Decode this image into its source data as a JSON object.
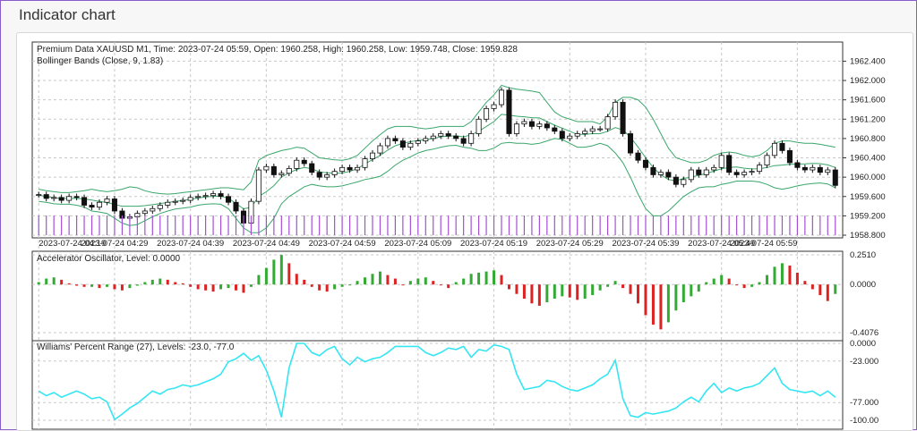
{
  "window": {
    "title": "Indicator chart"
  },
  "colors": {
    "bull": "#33aa33",
    "bear": "#dd2222",
    "wpr": "#33e6f2",
    "band": "#3aa66a",
    "accent": "#8a5cc8"
  },
  "chart_data": [
    {
      "type": "candlestick",
      "title": "Premium Data XAUUSD M1, Time: 2023-07-24 05:59, Open: 1960.258, High: 1960.258, Low: 1959.748, Close: 1959.828",
      "indicator_label": "Bollinger Bands (Close, 9, 1.83)",
      "ylim": [
        1958.8,
        1962.5
      ],
      "y_ticks": [
        "1962.400",
        "1962.000",
        "1961.600",
        "1961.200",
        "1960.800",
        "1960.400",
        "1960.000",
        "1959.600",
        "1959.200",
        "1958.800"
      ],
      "x_ticks": [
        "2023-07-24 04:19",
        "2023-07-24 04:29",
        "2023-07-24 04:39",
        "2023-07-24 04:49",
        "2023-07-24 04:59",
        "2023-07-24 05:09",
        "2023-07-24 05:19",
        "2023-07-24 05:29",
        "2023-07-24 05:39",
        "2023-07-24 05:49",
        "2023-07-24 05:59"
      ],
      "close": [
        1959.64,
        1959.56,
        1959.58,
        1959.52,
        1959.6,
        1959.58,
        1959.42,
        1959.38,
        1959.48,
        1959.55,
        1959.3,
        1959.15,
        1959.18,
        1959.25,
        1959.3,
        1959.35,
        1959.42,
        1959.48,
        1959.5,
        1959.52,
        1959.58,
        1959.6,
        1959.62,
        1959.66,
        1959.6,
        1959.48,
        1959.3,
        1959.05,
        1959.5,
        1960.15,
        1960.22,
        1960.05,
        1960.08,
        1960.18,
        1960.35,
        1960.28,
        1960.1,
        1960.0,
        1960.05,
        1960.12,
        1960.2,
        1960.15,
        1960.2,
        1960.38,
        1960.5,
        1960.65,
        1960.8,
        1960.75,
        1960.62,
        1960.7,
        1960.75,
        1960.8,
        1960.85,
        1960.9,
        1960.85,
        1960.8,
        1960.7,
        1960.9,
        1961.2,
        1961.42,
        1961.5,
        1961.8,
        1960.9,
        1961.1,
        1961.15,
        1961.05,
        1961.1,
        1961.02,
        1960.95,
        1960.8,
        1960.85,
        1960.9,
        1960.95,
        1961.0,
        1961.0,
        1961.25,
        1961.55,
        1960.9,
        1960.5,
        1960.35,
        1960.2,
        1960.05,
        1960.1,
        1960.0,
        1959.85,
        1959.95,
        1960.15,
        1960.05,
        1960.15,
        1960.2,
        1960.45,
        1960.1,
        1960.05,
        1960.1,
        1960.12,
        1960.25,
        1960.45,
        1960.7,
        1960.55,
        1960.3,
        1960.2,
        1960.15,
        1960.2,
        1960.1,
        1960.15,
        1959.83
      ],
      "bb_upper": [
        1959.75,
        1959.72,
        1959.7,
        1959.68,
        1959.68,
        1959.7,
        1959.72,
        1959.75,
        1959.72,
        1959.7,
        1959.72,
        1959.75,
        1959.8,
        1959.78,
        1959.72,
        1959.68,
        1959.66,
        1959.65,
        1959.66,
        1959.68,
        1959.7,
        1959.72,
        1959.74,
        1959.76,
        1959.78,
        1959.78,
        1959.76,
        1959.74,
        1959.9,
        1960.35,
        1960.45,
        1960.5,
        1960.55,
        1960.58,
        1960.62,
        1960.6,
        1960.5,
        1960.4,
        1960.38,
        1960.36,
        1960.35,
        1960.38,
        1960.45,
        1960.6,
        1960.75,
        1960.88,
        1961.0,
        1961.05,
        1961.05,
        1961.05,
        1961.02,
        1961.0,
        1961.02,
        1961.05,
        1961.05,
        1961.05,
        1961.05,
        1961.15,
        1961.35,
        1961.55,
        1961.7,
        1961.9,
        1961.85,
        1961.82,
        1961.8,
        1961.78,
        1961.75,
        1961.55,
        1961.35,
        1961.25,
        1961.2,
        1961.15,
        1961.15,
        1961.15,
        1961.1,
        1961.25,
        1961.55,
        1961.65,
        1961.65,
        1961.6,
        1961.45,
        1961.2,
        1960.9,
        1960.6,
        1960.4,
        1960.35,
        1960.3,
        1960.3,
        1960.35,
        1960.45,
        1960.5,
        1960.52,
        1960.5,
        1960.45,
        1960.42,
        1960.45,
        1960.55,
        1960.7,
        1960.75,
        1960.75,
        1960.72,
        1960.7,
        1960.7,
        1960.68,
        1960.65,
        1960.62
      ],
      "bb_lower": [
        1959.5,
        1959.48,
        1959.45,
        1959.44,
        1959.44,
        1959.42,
        1959.38,
        1959.3,
        1959.28,
        1959.25,
        1959.15,
        1959.05,
        1959.0,
        1959.02,
        1959.1,
        1959.18,
        1959.25,
        1959.3,
        1959.34,
        1959.36,
        1959.38,
        1959.42,
        1959.44,
        1959.45,
        1959.44,
        1959.35,
        1959.15,
        1958.95,
        1958.85,
        1958.85,
        1958.95,
        1959.15,
        1959.45,
        1959.6,
        1959.7,
        1959.8,
        1959.85,
        1959.82,
        1959.8,
        1959.8,
        1959.82,
        1959.86,
        1959.9,
        1959.95,
        1959.98,
        1960.02,
        1960.12,
        1960.25,
        1960.35,
        1960.42,
        1960.5,
        1960.55,
        1960.58,
        1960.62,
        1960.65,
        1960.66,
        1960.62,
        1960.6,
        1960.55,
        1960.55,
        1960.6,
        1960.7,
        1960.72,
        1960.7,
        1960.7,
        1960.68,
        1960.7,
        1960.75,
        1960.8,
        1960.78,
        1960.7,
        1960.62,
        1960.62,
        1960.65,
        1960.7,
        1960.65,
        1960.5,
        1960.3,
        1960.0,
        1959.65,
        1959.35,
        1959.2,
        1959.2,
        1959.3,
        1959.45,
        1959.6,
        1959.7,
        1959.78,
        1959.8,
        1959.8,
        1959.85,
        1959.88,
        1959.92,
        1959.92,
        1959.92,
        1959.9,
        1959.85,
        1959.78,
        1959.75,
        1959.78,
        1959.82,
        1959.85,
        1959.87,
        1959.88,
        1959.86,
        1959.78
      ]
    },
    {
      "type": "bar",
      "title": "Accelerator Oscillator, Level: 0.0000",
      "ylim": [
        -0.4076,
        0.251
      ],
      "y_ticks": [
        "0.2510",
        "0.0000",
        "-0.4076"
      ],
      "values": [
        0.02,
        0.05,
        0.06,
        0.04,
        0.01,
        -0.01,
        -0.02,
        -0.02,
        -0.03,
        -0.02,
        -0.04,
        -0.05,
        -0.03,
        -0.01,
        0.02,
        0.04,
        0.05,
        0.04,
        0.02,
        0.01,
        -0.02,
        -0.04,
        -0.05,
        -0.06,
        -0.04,
        -0.03,
        -0.05,
        -0.07,
        -0.02,
        0.08,
        0.14,
        0.21,
        0.25,
        0.18,
        0.09,
        0.04,
        -0.02,
        -0.05,
        -0.06,
        -0.04,
        -0.02,
        0.0,
        0.03,
        0.06,
        0.09,
        0.11,
        0.08,
        0.05,
        0.0,
        0.03,
        0.05,
        0.06,
        0.03,
        0.0,
        -0.03,
        0.02,
        0.05,
        0.09,
        0.1,
        0.11,
        0.12,
        0.08,
        -0.04,
        -0.08,
        -0.12,
        -0.16,
        -0.18,
        -0.15,
        -0.12,
        -0.1,
        -0.11,
        -0.13,
        -0.12,
        -0.09,
        -0.05,
        -0.02,
        0.03,
        -0.03,
        -0.08,
        -0.16,
        -0.26,
        -0.34,
        -0.38,
        -0.32,
        -0.22,
        -0.15,
        -0.1,
        -0.06,
        0.02,
        0.05,
        0.08,
        0.05,
        0.0,
        -0.03,
        -0.02,
        0.02,
        0.08,
        0.15,
        0.18,
        0.16,
        0.1,
        0.03,
        -0.04,
        -0.09,
        -0.14,
        -0.08
      ]
    },
    {
      "type": "line",
      "title": "Williams' Percent Range (27), Levels: -23.0, -77.0",
      "ylim": [
        -100.0,
        0.0
      ],
      "y_ticks": [
        "0.0000",
        "-23.000",
        "-77.000",
        "-100.00"
      ],
      "levels": [
        -23.0,
        -77.0
      ],
      "values": [
        -62,
        -68,
        -64,
        -70,
        -66,
        -62,
        -66,
        -72,
        -70,
        -76,
        -99,
        -92,
        -84,
        -78,
        -70,
        -62,
        -66,
        -60,
        -58,
        -54,
        -56,
        -54,
        -50,
        -46,
        -40,
        -24,
        -20,
        -13,
        -22,
        -16,
        -35,
        -62,
        -96,
        -32,
        0,
        0,
        -12,
        -16,
        -8,
        -4,
        -20,
        -28,
        -18,
        -24,
        -20,
        -18,
        -12,
        -4,
        -4,
        -4,
        -4,
        -12,
        -16,
        -12,
        -6,
        -8,
        -4,
        -18,
        -8,
        -10,
        -2,
        -4,
        -8,
        -40,
        -60,
        -58,
        -56,
        -48,
        -50,
        -56,
        -60,
        -62,
        -58,
        -54,
        -46,
        -40,
        -22,
        -72,
        -94,
        -96,
        -90,
        -92,
        -90,
        -88,
        -84,
        -76,
        -70,
        -76,
        -62,
        -52,
        -64,
        -58,
        -62,
        -58,
        -56,
        -52,
        -42,
        -32,
        -52,
        -60,
        -62,
        -64,
        -62,
        -68,
        -62,
        -70
      ]
    }
  ]
}
